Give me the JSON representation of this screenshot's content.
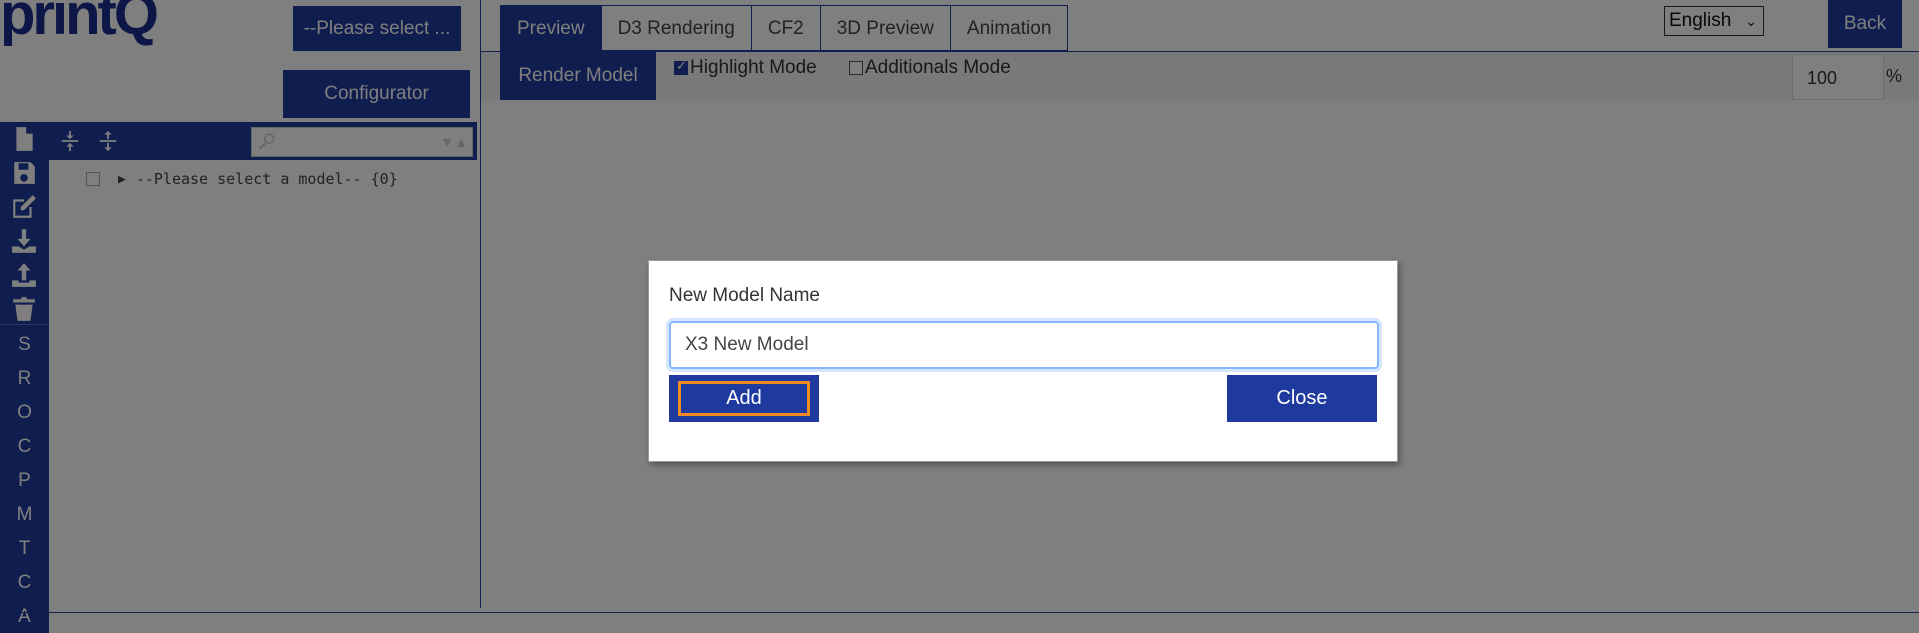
{
  "app": {
    "logo": "printQ",
    "model_select": "--Please select ...",
    "configurator_label": "Configurator",
    "back_label": "Back",
    "language": "English"
  },
  "tabs": [
    {
      "label": "Preview",
      "active": true
    },
    {
      "label": "D3 Rendering",
      "active": false
    },
    {
      "label": "CF2",
      "active": false
    },
    {
      "label": "3D Preview",
      "active": false
    },
    {
      "label": "Animation",
      "active": false
    }
  ],
  "toolbar": {
    "render_model_label": "Render Model",
    "highlight_mode_label": "Highlight Mode",
    "highlight_mode_checked": true,
    "additionals_mode_label": "Additionals Mode",
    "additionals_mode_checked": false,
    "zoom_value": "100",
    "zoom_unit": "%"
  },
  "sidebar": {
    "rail_icons": [
      "new-file-icon",
      "save-icon",
      "edit-icon",
      "download-icon",
      "upload-icon",
      "trash-icon"
    ],
    "rail_letters": [
      "S",
      "R",
      "O",
      "C",
      "P",
      "M",
      "T",
      "C",
      "A"
    ],
    "tree_icons": [
      "collapse-all-icon",
      "expand-all-icon"
    ],
    "tree_item": "--Please select a model-- {0}"
  },
  "modal": {
    "label": "New Model Name",
    "input_value": "X3 New Model",
    "add_label": "Add",
    "close_label": "Close"
  },
  "colors": {
    "brand": "#1e3a9f",
    "focus_outline": "#f08a24"
  }
}
